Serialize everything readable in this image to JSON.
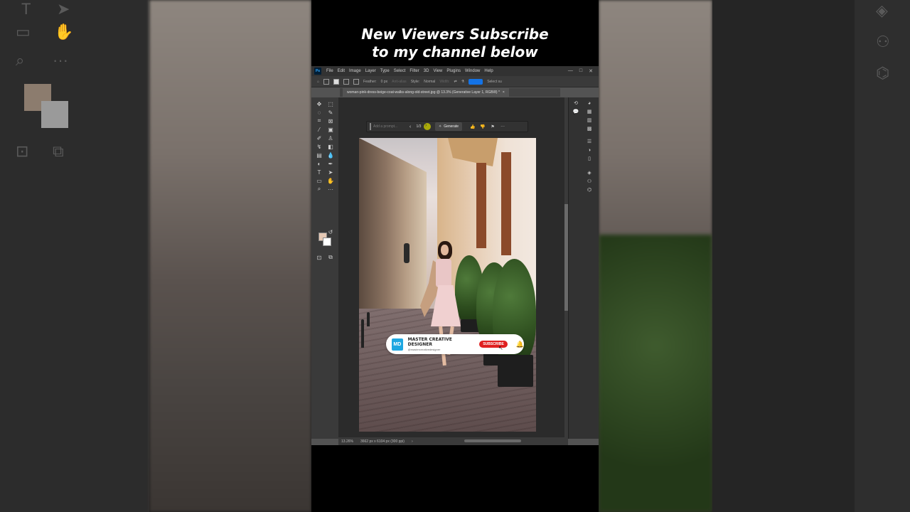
{
  "caption": {
    "line1": "New Viewers Subscribe",
    "line2": "to my channel below"
  },
  "photoshop": {
    "logo": "Ps",
    "menu": [
      "File",
      "Edit",
      "Image",
      "Layer",
      "Type",
      "Select",
      "Filter",
      "3D",
      "View",
      "Plugins",
      "Window",
      "Help"
    ],
    "window_controls": [
      "—",
      "□",
      "✕"
    ],
    "options": {
      "feather_label": "Feather:",
      "feather_value": "0 px",
      "anti_alias": "Anti-alias",
      "style_label": "Style:",
      "style_value": "Normal",
      "width_label": "Width:",
      "select_subject": "Select su"
    },
    "document_tab": "woman-pink-dress-beige-coat-walks-along-old-street.jpg @ 13.3% (Generative Layer 1, RGB/8) *",
    "tab_close": "×",
    "context_bar": {
      "prompt_placeholder": "Add a prompt...",
      "variation_count": "1/3",
      "prev": "‹",
      "next": "›",
      "generate_label": "Generate",
      "more": "···"
    },
    "status": {
      "zoom": "13.26%",
      "dimensions": "3662 px x 6104 px (300 ppi)",
      "arrow": "›"
    }
  },
  "subscribe_banner": {
    "logo_text": "MD",
    "channel_name": "MASTER CREATIVE DESIGNER",
    "handle": "@mastercreativedesigner",
    "button": "SUBSCRIBE"
  },
  "colors": {
    "accent_blue": "#1473e6",
    "subscribe_red": "#e02020",
    "foreground_swatch": "#e6c9b5",
    "background_swatch": "#ffffff"
  }
}
